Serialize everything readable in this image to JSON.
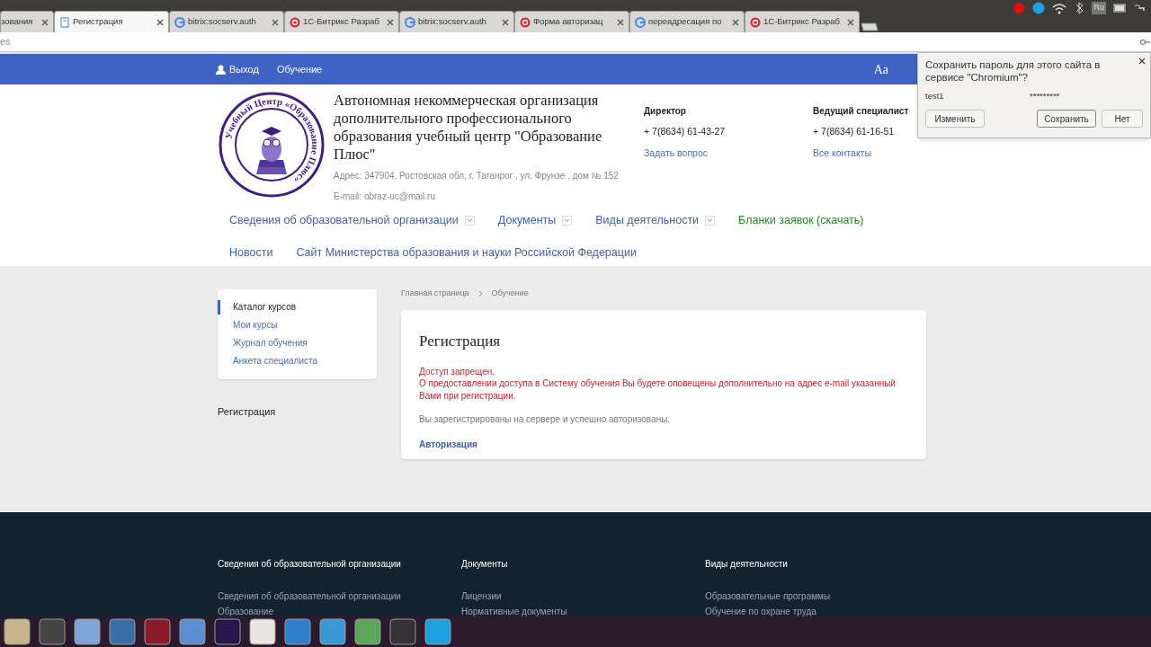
{
  "browser": {
    "tabs": [
      {
        "title": "зования",
        "selected": false
      },
      {
        "title": "Регистрация",
        "kind": "doc",
        "selected": true
      },
      {
        "title": "bitrix:socserv.auth",
        "kind": "google",
        "selected": false
      },
      {
        "title": "1С-Битрикс Разраб",
        "kind": "bitrix",
        "selected": false
      },
      {
        "title": "bitrix:socserv.auth",
        "kind": "google",
        "selected": false
      },
      {
        "title": "Форма авторизац",
        "kind": "bitrix",
        "selected": false
      },
      {
        "title": "переадресация по",
        "kind": "google",
        "selected": false
      },
      {
        "title": "1С-Битрикс Разраб",
        "kind": "bitrix",
        "selected": false
      }
    ],
    "address": "es",
    "tray": {
      "keyboard": "Ru"
    }
  },
  "topbar": {
    "links": [
      "Выход",
      "Обучение"
    ],
    "font_toggle": "Aa"
  },
  "header": {
    "logo_text": "Учебный Центр «Образование Плюс»",
    "org_name": "Автономная некоммерческая организация дополнительного профессионального образования учебный центр \"Образование Плюс\"",
    "address": "Адрес: 347904, Ростовская обл, г. Таганрог , ул. Фрунзе , дом № 152",
    "email": "E-mail: obraz-uc@mail.ru",
    "contacts": [
      {
        "title": "Директор",
        "phone": "+ 7(8634) 61-43-27",
        "link": "Задать вопрос"
      },
      {
        "title": "Ведущий специалист",
        "phone": "+ 7(8634) 61-16-51",
        "link": "Все контакты"
      }
    ]
  },
  "nav": [
    [
      {
        "label": "Сведения об образовательной организации",
        "dropdown": true,
        "kind": "normal"
      },
      {
        "label": "Документы",
        "dropdown": true,
        "kind": "normal"
      },
      {
        "label": "Виды деятельности",
        "dropdown": true,
        "kind": "normal"
      },
      {
        "label": "Бланки заявок (скачать)",
        "dropdown": false,
        "kind": "highlight"
      }
    ],
    [
      {
        "label": "Новости",
        "dropdown": false,
        "kind": "normal"
      },
      {
        "label": "Сайт Министерства образования и науки Российской Федерации",
        "dropdown": false,
        "kind": "normal"
      }
    ]
  ],
  "sidebar": {
    "items": [
      {
        "label": "Каталог курсов",
        "selected": true
      },
      {
        "label": "Мои курсы",
        "selected": false
      },
      {
        "label": "Журнал обучения",
        "selected": false
      },
      {
        "label": "Анкета специалиста",
        "selected": false
      }
    ],
    "below": "Регистрация"
  },
  "breadcrumbs": [
    "Главная страница",
    "Обучение"
  ],
  "content": {
    "title": "Регистрация",
    "errors": [
      "Доступ запрещен.",
      "О предоставлении доступа в Систему обучения Вы будете оповещены дополнительно на адрес e-mail указанный Вами при регистрации."
    ],
    "message": "Вы зарегистрированы на сервере и успешно авторизованы.",
    "link": "Авторизация"
  },
  "footer": {
    "columns": [
      {
        "title": "Сведения об образовательной организации",
        "links": [
          "Сведения об образовательной организации",
          "Образование"
        ]
      },
      {
        "title": "Документы",
        "links": [
          "Лицензии",
          "Нормативные документы"
        ]
      },
      {
        "title": "Виды деятельности",
        "links": [
          "Образовательные программы",
          "Обучение по охране труда"
        ]
      }
    ]
  },
  "password_popup": {
    "question": "Сохранить пароль для этого сайта в сервисе \"Chromium\"?",
    "username": "test1",
    "password": "*********",
    "buttons": [
      {
        "label": "Изменить",
        "kind": "secondary"
      },
      {
        "label": "Сохранить",
        "kind": "primary"
      },
      {
        "label": "Нет",
        "kind": "secondary"
      }
    ]
  }
}
